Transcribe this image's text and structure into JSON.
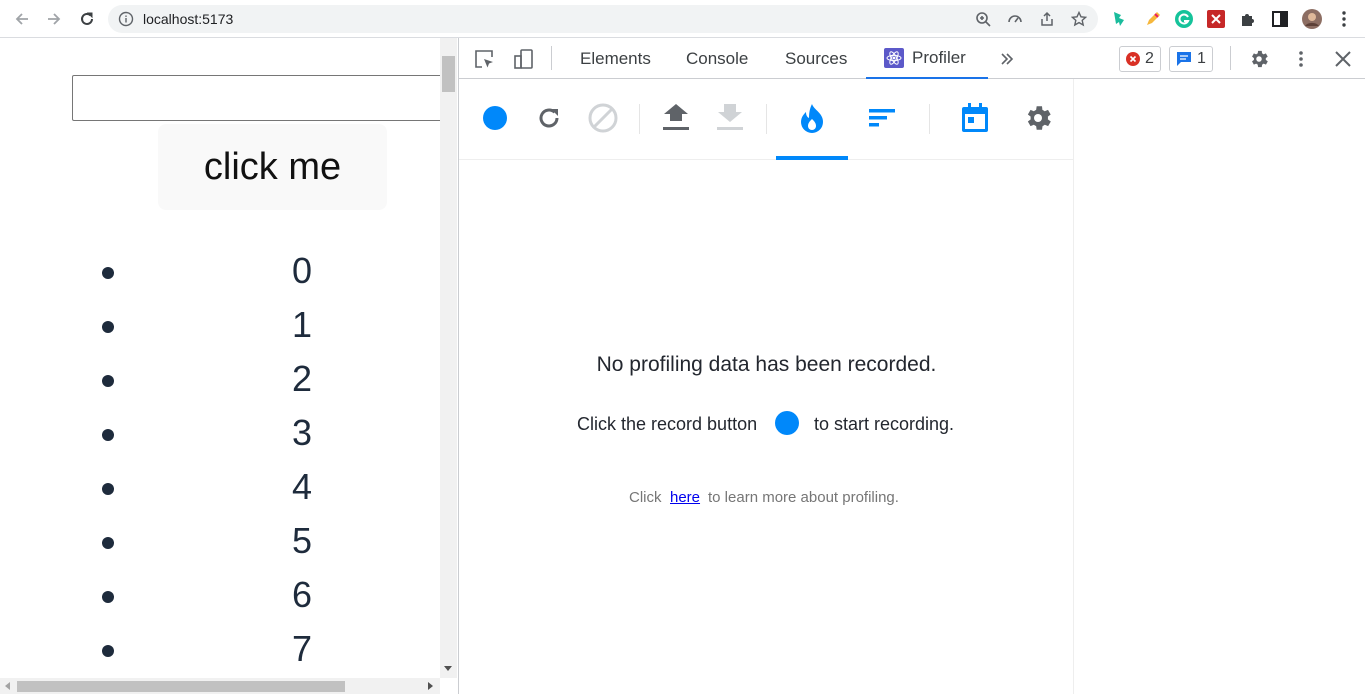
{
  "browser": {
    "url": "localhost:5173"
  },
  "page": {
    "input_value": "",
    "button_label": "click me",
    "list_items": [
      "0",
      "1",
      "2",
      "3",
      "4",
      "5",
      "6",
      "7"
    ],
    "text_color": "#1e2b3c"
  },
  "devtools": {
    "tabs": [
      {
        "label": "Elements"
      },
      {
        "label": "Console"
      },
      {
        "label": "Sources"
      },
      {
        "label": "Profiler",
        "active": true
      }
    ],
    "error_count": "2",
    "message_count": "1",
    "accent": "#1a73e8"
  },
  "profiler": {
    "empty_title": "No profiling data has been recorded.",
    "instruction_before": "Click the record button",
    "instruction_after": "to start recording.",
    "learn_before": "Click",
    "learn_link": "here",
    "learn_after": "to learn more about profiling.",
    "accent": "#0088fa",
    "icons": [
      "record-icon",
      "reload-and-profile-icon",
      "clear-icon",
      "load-profile-icon",
      "save-profile-icon",
      "flamegraph-icon",
      "ranked-chart-icon",
      "timeline-icon",
      "settings-icon"
    ]
  }
}
